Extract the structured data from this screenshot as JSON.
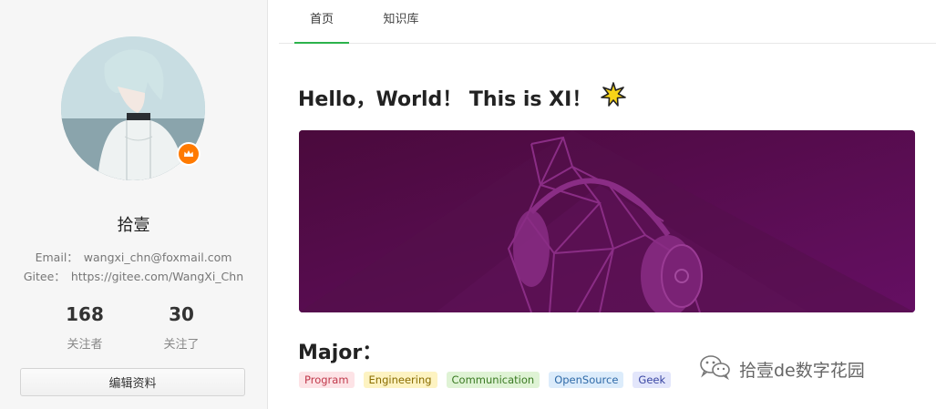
{
  "profile": {
    "username": "拾壹",
    "email_label": "Email：",
    "email_value": "wangxi_chn@foxmail.com",
    "gitee_label": "Gitee：",
    "gitee_value": "https://gitee.com/WangXi_Chn",
    "following_count": "168",
    "following_label": "关注者",
    "followed_count": "30",
    "followed_label": "关注了",
    "edit_button": "编辑资料"
  },
  "tabs": [
    {
      "label": "首页"
    },
    {
      "label": "知识库"
    }
  ],
  "main": {
    "heading": "Hello，World！ This is XI！",
    "star_icon": "sparkle-star-icon",
    "major_heading": "Major：",
    "tags": [
      {
        "label": "Program",
        "bg": "#fde3e6",
        "color": "#c0394b"
      },
      {
        "label": "Engineering",
        "bg": "#fdf3c2",
        "color": "#8a6d00"
      },
      {
        "label": "Communication",
        "bg": "#dff3d5",
        "color": "#3a7a22"
      },
      {
        "label": "OpenSource",
        "bg": "#dcecfb",
        "color": "#2f6aa8"
      },
      {
        "label": "Geek",
        "bg": "#e3e6fb",
        "color": "#3a47a3"
      }
    ]
  },
  "watermark": {
    "text": "拾壹de数字花园",
    "icon": "wechat-icon"
  },
  "colors": {
    "accent": "#2bb24c",
    "badge": "#ff7a00",
    "banner": "#5b0f52"
  }
}
